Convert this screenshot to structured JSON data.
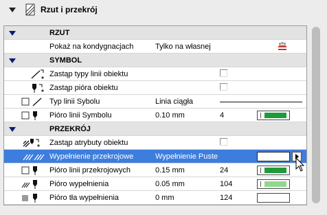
{
  "panel": {
    "title": "Rzut i przekrój"
  },
  "rows": {
    "rzut_header": "RZUT",
    "pokaz": {
      "name": "Pokaż na kondygnacjach",
      "value": "Tylko na własnej"
    },
    "symbol_header": "SYMBOL",
    "zastap_typy": {
      "name": "Zastąp typy linii obiektu"
    },
    "zastap_piora": {
      "name": "Zastąp pióra obiektu"
    },
    "typ_linii": {
      "name": "Typ linii Sybolu",
      "value": "Linia ciągła"
    },
    "pioro_linii_symbolu": {
      "name": "Pióro linii Symbolu",
      "value": "0.10 mm",
      "num": "4"
    },
    "przekroj_header": "PRZEKRÓJ",
    "zastap_atrybuty": {
      "name": "Zastąp atrybuty obiektu"
    },
    "wypelnienie": {
      "name": "Wypełnienie przekrojowe",
      "value": "Wypełnienie Puste"
    },
    "pioro_linii_przekrojowych": {
      "name": "Pióro linii przekrojowych",
      "value": "0.15 mm",
      "num": "24"
    },
    "pioro_wypelnienia": {
      "name": "Pióro wypełnienia",
      "value": "0.05 mm",
      "num": "104"
    },
    "pioro_tla": {
      "name": "Pióro tła wypełnienia",
      "value": "0 mm",
      "num": "124"
    }
  },
  "colors": {
    "selection": "#3d7ddd",
    "section_arrow": "#0a1c78",
    "pen_green_dark": "#1e9a3a",
    "pen_green_light": "#8fd88f"
  },
  "icons": [
    "collapse-arrow",
    "section-plan-icon",
    "layer-stack-icon",
    "line-type-icon",
    "pen-icon",
    "fill-hatch-icon",
    "checkbox-icon"
  ]
}
